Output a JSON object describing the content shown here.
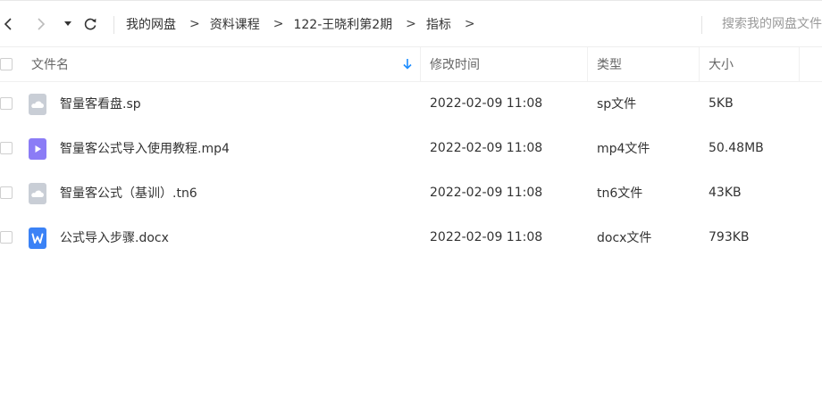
{
  "nav": {
    "back": "back-icon",
    "forward": "forward-icon",
    "history": "history-dropdown-icon",
    "refresh": "refresh-icon"
  },
  "breadcrumb": {
    "items": [
      "我的网盘",
      "资料课程",
      "122-王晓利第2期",
      "指标"
    ],
    "separator": ">"
  },
  "search": {
    "placeholder": "搜索我的网盘文件"
  },
  "table": {
    "columns": {
      "name": "文件名",
      "modified": "修改时间",
      "type": "类型",
      "size": "大小"
    },
    "rows": [
      {
        "name": "智量客看盘.sp",
        "modified": "2022-02-09 11:08",
        "type": "sp文件",
        "size": "5KB",
        "icon": "generic-file-icon"
      },
      {
        "name": "智量客公式导入使用教程.mp4",
        "modified": "2022-02-09 11:08",
        "type": "mp4文件",
        "size": "50.48MB",
        "icon": "video-file-icon"
      },
      {
        "name": "智量客公式（基训）.tn6",
        "modified": "2022-02-09 11:08",
        "type": "tn6文件",
        "size": "43KB",
        "icon": "generic-file-icon"
      },
      {
        "name": "公式导入步骤.docx",
        "modified": "2022-02-09 11:08",
        "type": "docx文件",
        "size": "793KB",
        "icon": "word-file-icon"
      }
    ]
  },
  "colors": {
    "accent": "#1a8cff",
    "word_blue": "#3b82f6",
    "video_purple": "#8b7cf6",
    "generic_gray": "#c9ced6"
  }
}
